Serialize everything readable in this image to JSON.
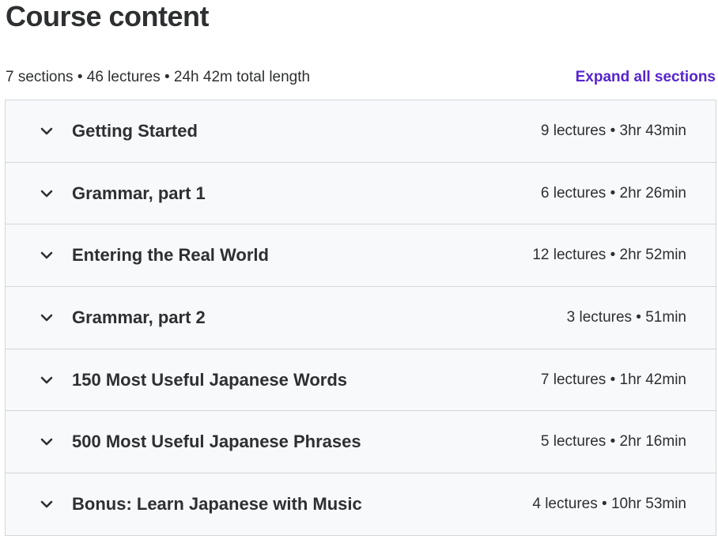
{
  "header": {
    "title": "Course content"
  },
  "summary": {
    "text": "7 sections • 46 lectures • 24h 42m total length",
    "expand_label": "Expand all sections"
  },
  "colors": {
    "link": "#5624d0",
    "row_background": "#f7f9fa",
    "border": "#d1d7dc",
    "text": "#2d2f31"
  },
  "sections": [
    {
      "title": "Getting Started",
      "meta": "9 lectures • 3hr 43min",
      "icon": "chevron-down-icon"
    },
    {
      "title": "Grammar, part 1",
      "meta": "6 lectures • 2hr 26min",
      "icon": "chevron-down-icon"
    },
    {
      "title": "Entering the Real World",
      "meta": "12 lectures • 2hr 52min",
      "icon": "chevron-down-icon"
    },
    {
      "title": "Grammar, part 2",
      "meta": "3 lectures • 51min",
      "icon": "chevron-down-icon"
    },
    {
      "title": "150 Most Useful Japanese Words",
      "meta": "7 lectures • 1hr 42min",
      "icon": "chevron-down-icon"
    },
    {
      "title": "500 Most Useful Japanese Phrases",
      "meta": "5 lectures • 2hr 16min",
      "icon": "chevron-down-icon"
    },
    {
      "title": "Bonus: Learn Japanese with Music",
      "meta": "4 lectures • 10hr 53min",
      "icon": "chevron-down-icon"
    }
  ]
}
